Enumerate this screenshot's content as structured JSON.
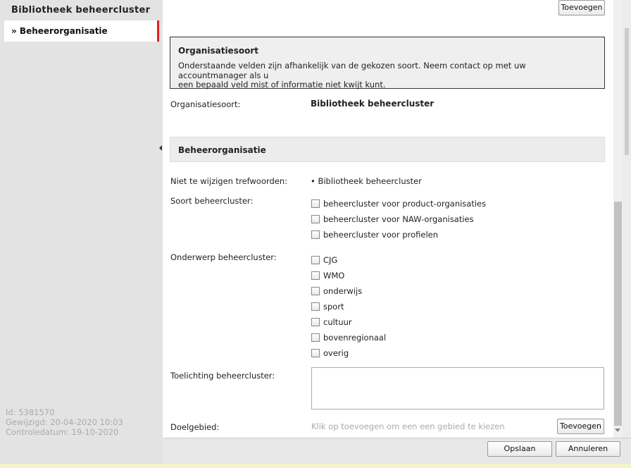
{
  "sidebar": {
    "title": "Bibliotheek beheercluster",
    "active_item": "» Beheerorganisatie",
    "meta": {
      "id": "Id: 5381570",
      "modified": "Gewijzigd: 20-04-2020 10:03",
      "control_date": "Controledatum: 19-10-2020"
    }
  },
  "top_add_button": "Toevoegen",
  "notice": {
    "title": "Organisatiesoort",
    "text_line1": "Onderstaande velden zijn afhankelijk van de gekozen soort. Neem contact op met uw accountmanager als u",
    "text_line2": "een bepaald veld mist of informatie niet kwijt kunt."
  },
  "org_type": {
    "label": "Organisatiesoort:",
    "value": "Bibliotheek beheercluster"
  },
  "section": {
    "title": "Beheerorganisatie"
  },
  "keywords": {
    "label": "Niet te wijzigen trefwoorden:",
    "value": "• Bibliotheek beheercluster"
  },
  "cluster_type": {
    "label": "Soort beheercluster:",
    "options": [
      "beheercluster voor product-organisaties",
      "beheercluster voor NAW-organisaties",
      "beheercluster voor profielen"
    ]
  },
  "cluster_subject": {
    "label": "Onderwerp beheercluster:",
    "options": [
      "CJG",
      "WMO",
      "onderwijs",
      "sport",
      "cultuur",
      "bovenregionaal",
      "overig"
    ]
  },
  "explanation": {
    "label": "Toelichting beheercluster:"
  },
  "target_area": {
    "label": "Doelgebied:",
    "hint": "Klik op toevoegen om een een gebied te kiezen",
    "button": "Toevoegen"
  },
  "footer": {
    "save": "Opslaan",
    "cancel": "Annuleren"
  }
}
